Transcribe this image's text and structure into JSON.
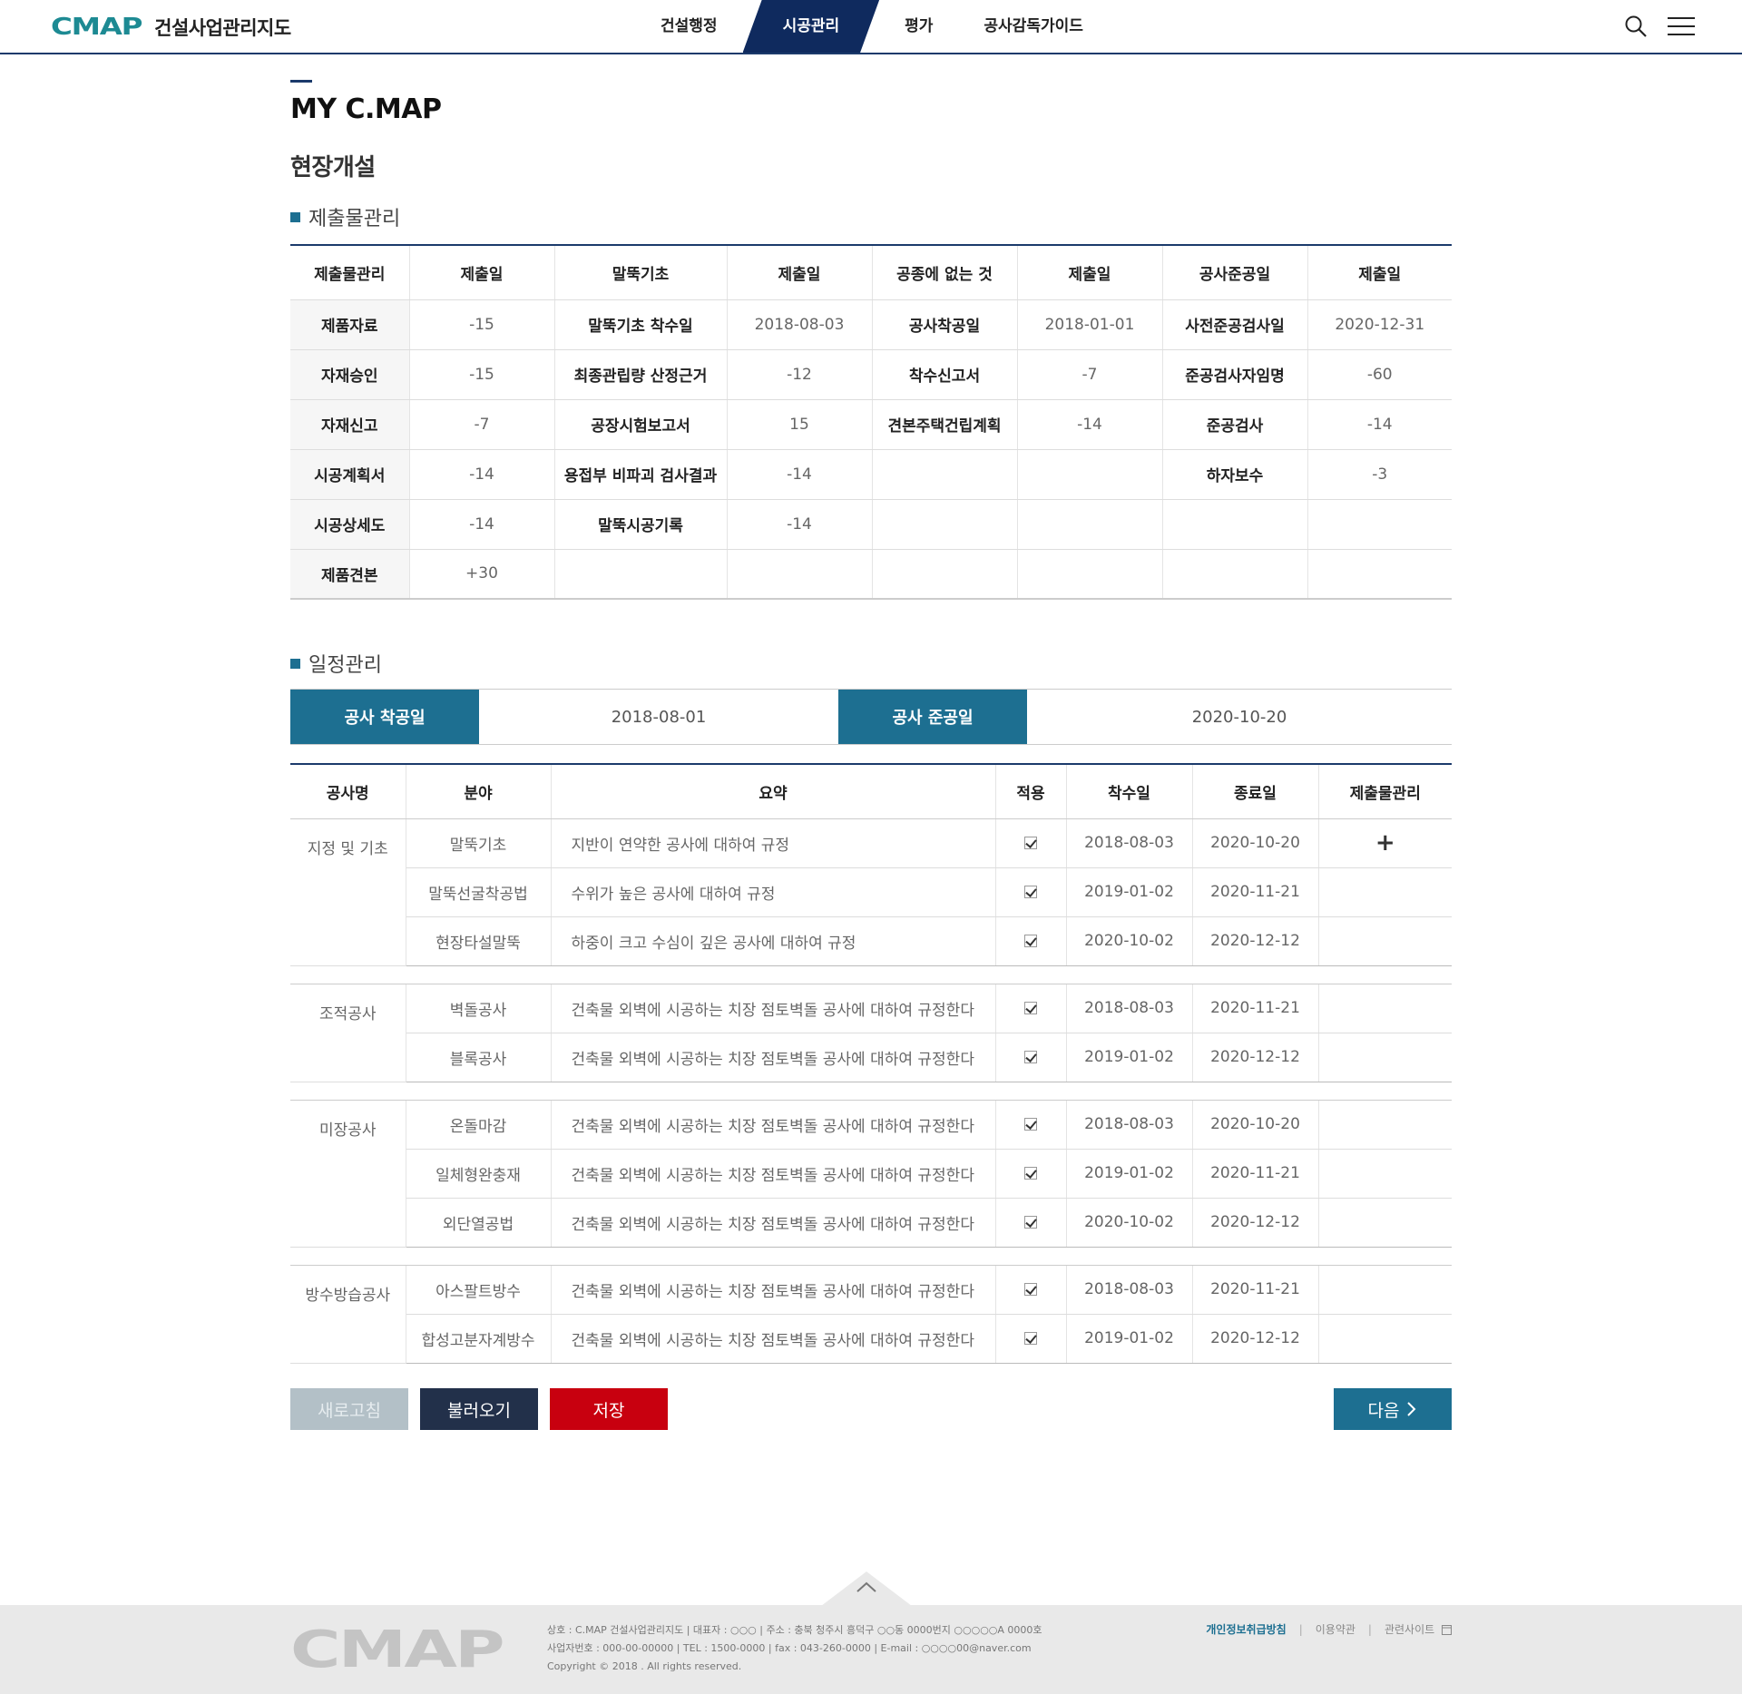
{
  "header": {
    "logo_mark": "CMAP",
    "logo_text": "건설사업관리지도",
    "nav": [
      "건설행정",
      "시공관리",
      "평가",
      "공사감독가이드"
    ],
    "active_nav": "시공관리"
  },
  "page": {
    "title": "MY C.MAP",
    "subtitle": "현장개설"
  },
  "submission": {
    "section_label": "제출물관리",
    "headers": [
      "제출물관리",
      "제출일",
      "말뚝기초",
      "제출일",
      "공종에 없는 것",
      "제출일",
      "공사준공일",
      "제출일"
    ],
    "rows": [
      [
        "제품자료",
        "-15",
        "말뚝기초 착수일",
        "2018-08-03",
        "공사착공일",
        "2018-01-01",
        "사전준공검사일",
        "2020-12-31"
      ],
      [
        "자재승인",
        "-15",
        "최종관립량 산정근거",
        "-12",
        "착수신고서",
        "-7",
        "준공검사자임명",
        "-60"
      ],
      [
        "자재신고",
        "-7",
        "공장시험보고서",
        "15",
        "견본주택건립계획",
        "-14",
        "준공검사",
        "-14"
      ],
      [
        "시공계획서",
        "-14",
        "용접부 비파괴 검사결과",
        "-14",
        "",
        "",
        "하자보수",
        "-3"
      ],
      [
        "시공상세도",
        "-14",
        "말뚝시공기록",
        "-14",
        "",
        "",
        "",
        ""
      ],
      [
        "제품견본",
        "+30",
        "",
        "",
        "",
        "",
        "",
        ""
      ]
    ]
  },
  "schedule": {
    "section_label": "일정관리",
    "start_label": "공사 착공일",
    "start_date": "2018-08-01",
    "end_label": "공사 준공일",
    "end_date": "2020-10-20",
    "headers": [
      "공사명",
      "분야",
      "요약",
      "적용",
      "착수일",
      "종료일",
      "제출물관리"
    ],
    "groups": [
      {
        "name": "지정 및 기초",
        "rows": [
          {
            "field": "말뚝기초",
            "summary": "지반이 연약한 공사에 대하여 규정",
            "start": "2018-08-03",
            "end": "2020-10-20",
            "submit": "+"
          },
          {
            "field": "말뚝선굴착공법",
            "summary": "수위가 높은 공사에 대하여 규정",
            "start": "2019-01-02",
            "end": "2020-11-21",
            "submit": ""
          },
          {
            "field": "현장타설말뚝",
            "summary": "하중이 크고 수심이 깊은 공사에 대하여 규정",
            "start": "2020-10-02",
            "end": "2020-12-12",
            "submit": ""
          }
        ]
      },
      {
        "name": "조적공사",
        "rows": [
          {
            "field": "벽돌공사",
            "summary": "건축물 외벽에 시공하는 치장 점토벽돌 공사에 대하여 규정한다",
            "start": "2018-08-03",
            "end": "2020-11-21",
            "submit": ""
          },
          {
            "field": "블록공사",
            "summary": "건축물 외벽에 시공하는 치장 점토벽돌 공사에 대하여 규정한다",
            "start": "2019-01-02",
            "end": "2020-12-12",
            "submit": ""
          }
        ]
      },
      {
        "name": "미장공사",
        "rows": [
          {
            "field": "온돌마감",
            "summary": "건축물 외벽에 시공하는 치장 점토벽돌 공사에 대하여 규정한다",
            "start": "2018-08-03",
            "end": "2020-10-20",
            "submit": ""
          },
          {
            "field": "일체형완충재",
            "summary": "건축물 외벽에 시공하는 치장 점토벽돌 공사에 대하여 규정한다",
            "start": "2019-01-02",
            "end": "2020-11-21",
            "submit": ""
          },
          {
            "field": "외단열공법",
            "summary": "건축물 외벽에 시공하는 치장 점토벽돌 공사에 대하여 규정한다",
            "start": "2020-10-02",
            "end": "2020-12-12",
            "submit": ""
          }
        ]
      },
      {
        "name": "방수방습공사",
        "rows": [
          {
            "field": "아스팔트방수",
            "summary": "건축물 외벽에 시공하는 치장 점토벽돌 공사에 대하여 규정한다",
            "start": "2018-08-03",
            "end": "2020-11-21",
            "submit": ""
          },
          {
            "field": "합성고분자계방수",
            "summary": "건축물 외벽에 시공하는 치장 점토벽돌 공사에 대하여 규정한다",
            "start": "2019-01-02",
            "end": "2020-12-12",
            "submit": ""
          }
        ]
      }
    ]
  },
  "buttons": {
    "refresh": "새로고침",
    "load": "불러오기",
    "save": "저장",
    "next": "다음"
  },
  "footer": {
    "logo": "CMAP",
    "info_line1": "상호 : C.MAP 건설사업관리지도  |  대표자 : ○○○  |  주소 : 충북 청주시 흥덕구 ○○동 0000번지 ○○○○○A 0000호",
    "info_line2": "사업자번호 : 000-00-00000  |  TEL : 1500-0000  |  fax : 043-260-0000  |  E-mail : ○○○○00@naver.com",
    "copyright": "Copyright © 2018 . All rights reserved.",
    "links": [
      "개인정보취급방침",
      "이용약관",
      "관련사이트"
    ]
  },
  "colors": {
    "navy": "#1b3a6b",
    "teal": "#1d6f91",
    "red": "#c8000f",
    "dark": "#22304a"
  }
}
